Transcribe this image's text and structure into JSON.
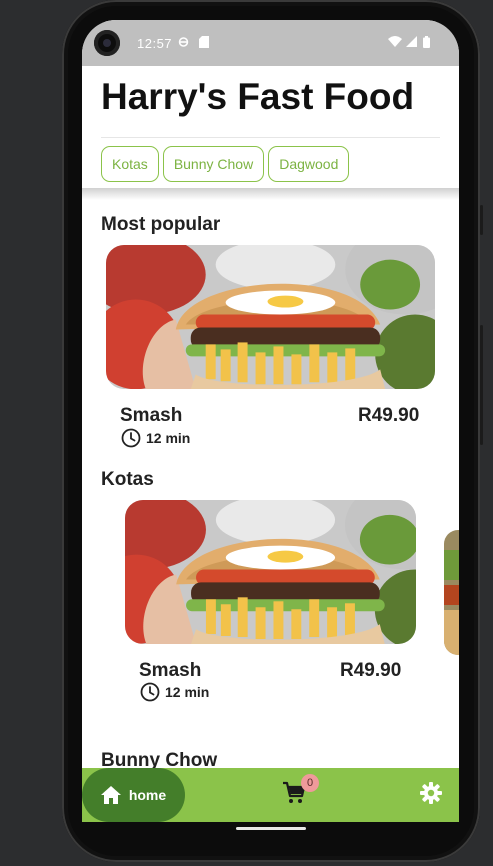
{
  "status_bar": {
    "time": "12:57"
  },
  "header": {
    "title": "Harry's Fast Food"
  },
  "categories": [
    "Kotas",
    "Bunny Chow",
    "Dagwood"
  ],
  "sections": {
    "most_popular": {
      "title": "Most popular",
      "item": {
        "name": "Smash",
        "price": "R49.90",
        "time": "12 min"
      }
    },
    "kotas": {
      "title": "Kotas",
      "item": {
        "name": "Smash",
        "price": "R49.90",
        "time": "12 min"
      }
    },
    "bunny_chow": {
      "title": "Bunny Chow"
    }
  },
  "nav": {
    "home_label": "home",
    "cart_count": "0"
  },
  "colors": {
    "accent": "#8bc34a",
    "accent_dark": "#447e2a",
    "chip_text": "#7cb342",
    "badge": "#ef9a9a"
  },
  "icons": [
    "clock-icon",
    "home-icon",
    "cart-icon",
    "gear-icon"
  ]
}
